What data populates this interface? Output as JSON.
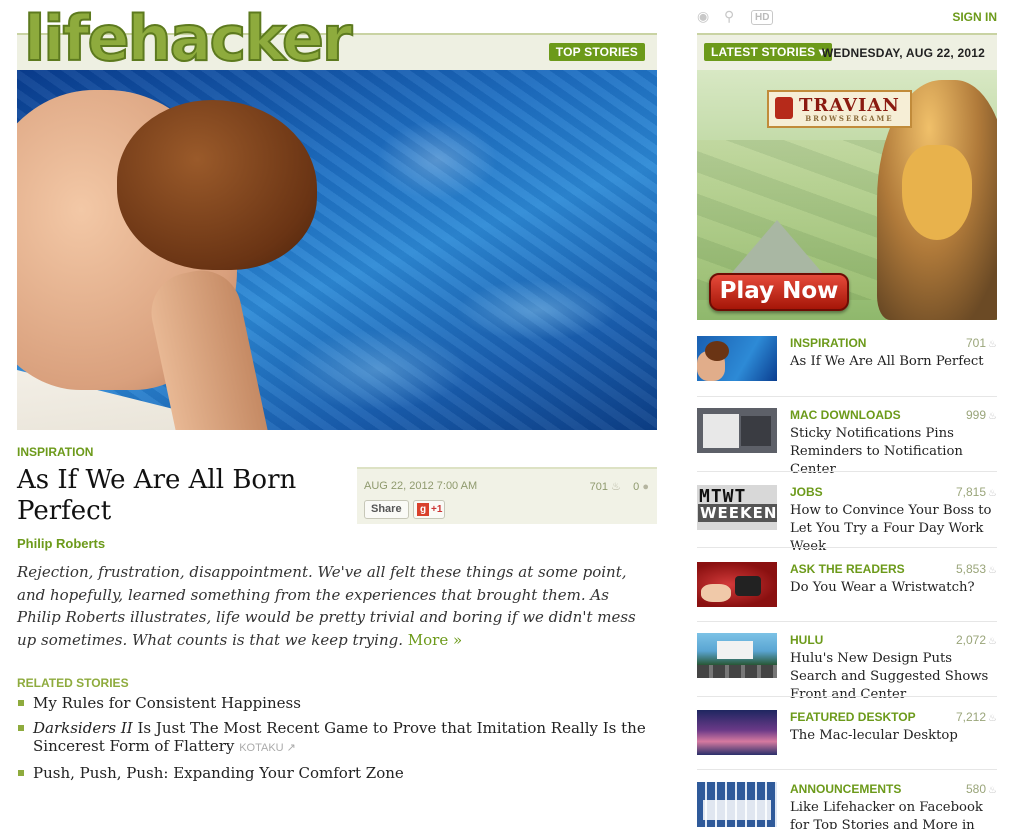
{
  "header": {
    "logo": "lifehacker",
    "top_stories": "TOP STORIES",
    "sign_in": "SIGN IN",
    "icons": [
      "eye-icon",
      "search-icon",
      "hd-badge"
    ],
    "hd_label": "HD",
    "latest_stories": "LATEST STORIES",
    "date": "WEDNESDAY, AUG 22, 2012"
  },
  "article": {
    "category": "INSPIRATION",
    "title": "As If We Are All Born Perfect",
    "author": "Philip Roberts",
    "date": "AUG 22, 2012 7:00 AM",
    "views": "701",
    "comments": "0",
    "share_label": "Share",
    "gplus_label": "+1",
    "excerpt": "Rejection, frustration, disappointment. We've all felt these things at some point, and hopefully, learned something from the experiences that brought them. As Philip Roberts illustrates, life would be pretty trivial and boring if we didn't mess up sometimes. What counts is that we keep trying.",
    "more_label": "More »",
    "related_heading": "RELATED STORIES",
    "related": [
      {
        "title": "My Rules for Consistent Happiness"
      },
      {
        "title_italic": "Darksiders II",
        "title_rest": " Is Just The Most Recent Game to Prove that Imitation Really Is the Sincerest Form of Flattery",
        "source": "KOTAKU"
      },
      {
        "title": "Push, Push, Push: Expanding Your Comfort Zone"
      }
    ]
  },
  "ad": {
    "brand": "TRAVIAN",
    "brand_sub": "BROWSERGAME",
    "cta": "Play Now"
  },
  "sidebar": {
    "items": [
      {
        "category": "INSPIRATION",
        "count": "701",
        "title": "As If We Are All Born Perfect"
      },
      {
        "category": "MAC DOWNLOADS",
        "count": "999",
        "title": "Sticky Notifications Pins Reminders to Notification Center"
      },
      {
        "category": "JOBS",
        "count": "7,815",
        "title": "How to Convince Your Boss to Let You Try a Four Day Work Week",
        "thumb_text": [
          "MTWT",
          "WEEKEND"
        ]
      },
      {
        "category": "ASK THE READERS",
        "count": "5,853",
        "title": "Do You Wear a Wristwatch?"
      },
      {
        "category": "HULU",
        "count": "2,072",
        "title": "Hulu's New Design Puts Search and Suggested Shows Front and Center"
      },
      {
        "category": "FEATURED DESKTOP",
        "count": "7,212",
        "title": "The Mac-lecular Desktop"
      },
      {
        "category": "ANNOUNCEMENTS",
        "count": "580",
        "title": "Like Lifehacker on Facebook for Top Stories and More in Your Feed"
      }
    ]
  },
  "colors": {
    "accent": "#6c9a1a",
    "header_band": "#eef0e2"
  }
}
